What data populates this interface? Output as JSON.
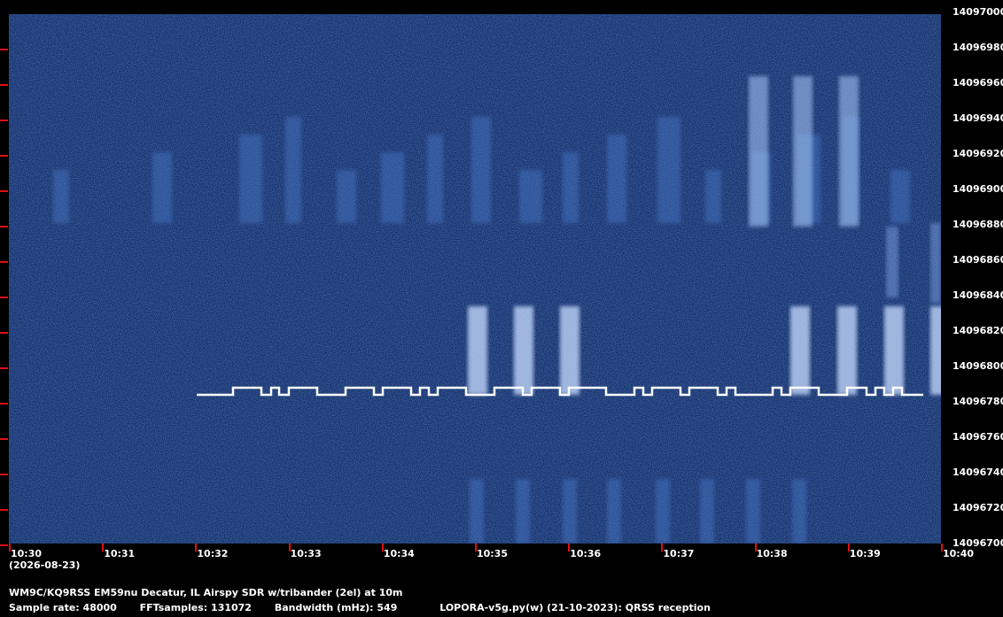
{
  "colors": {
    "background": "#000000",
    "waterfall": "#0c2a66",
    "signal": "#ffffff",
    "ticks": "#e01010"
  },
  "y_axis_labels": [
    "14097000",
    "14096980",
    "14096960",
    "14096940",
    "14096920",
    "14096900",
    "14096880",
    "14096860",
    "14096840",
    "14096820",
    "14096800",
    "14096780",
    "14096760",
    "14096740",
    "14096720",
    "14096700"
  ],
  "x_axis_labels": [
    "10:30",
    "10:31",
    "10:32",
    "10:33",
    "10:34",
    "10:35",
    "10:36",
    "10:37",
    "10:38",
    "10:39",
    "10:40"
  ],
  "date_label": "(2026-08-23)",
  "station_line": "WM9C/KQ9RSS EM59nu Decatur, IL  Airspy SDR w/tribander (2el) at 10m",
  "stats": {
    "sample_rate": "Sample rate: 48000",
    "fft_samples": "FFTsamples: 131072",
    "bandwidth": "Bandwidth (mHz): 549",
    "software": "LOPORA-v5g.py(w) (21-10-2023): QRSS reception"
  }
}
